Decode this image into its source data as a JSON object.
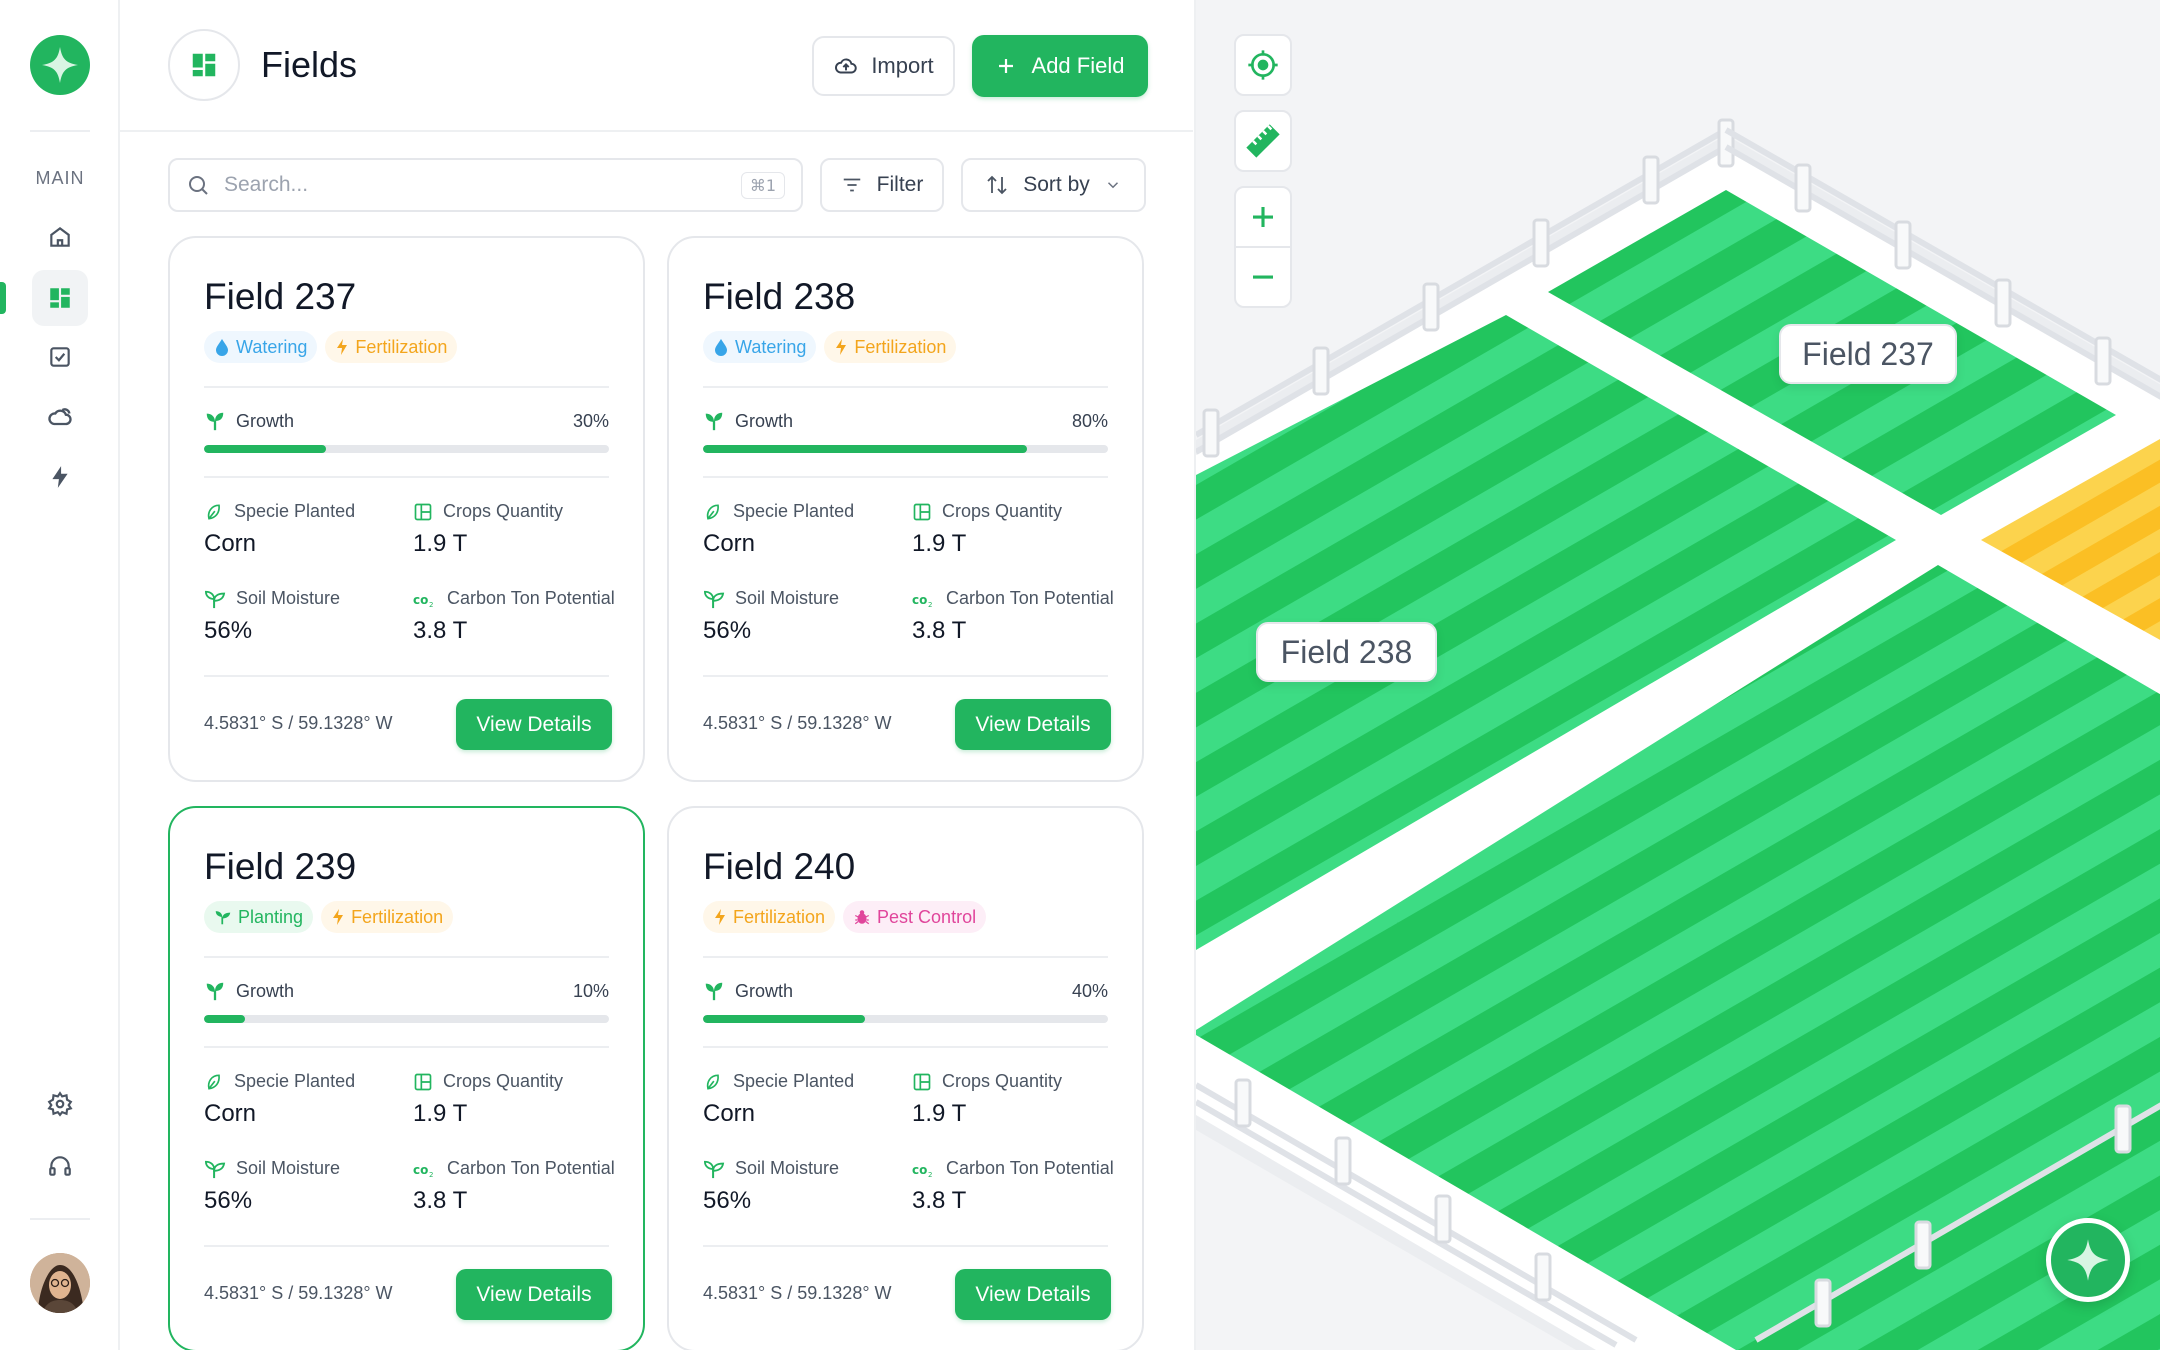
{
  "sidebar": {
    "section_label": "MAIN",
    "items": [
      {
        "name": "home-icon"
      },
      {
        "name": "dashboard-icon",
        "active": true
      },
      {
        "name": "tasks-icon"
      },
      {
        "name": "weather-icon"
      },
      {
        "name": "energy-icon"
      }
    ],
    "bottom_items": [
      {
        "name": "settings-icon"
      },
      {
        "name": "support-icon"
      }
    ]
  },
  "header": {
    "title": "Fields",
    "import_label": "Import",
    "add_label": "Add Field"
  },
  "toolbar": {
    "search_placeholder": "Search...",
    "search_shortcut": "⌘1",
    "filter_label": "Filter",
    "sort_label": "Sort by"
  },
  "cards": [
    {
      "title": "Field 237",
      "tags": [
        {
          "label": "Watering",
          "kind": "water"
        },
        {
          "label": "Fertilization",
          "kind": "fert"
        }
      ],
      "growth_label": "Growth",
      "growth_pct": "30%",
      "growth_value": 0.3,
      "specie_label": "Specie Planted",
      "specie": "Corn",
      "crops_label": "Crops Quantity",
      "crops": "1.9 T",
      "moisture_label": "Soil Moisture",
      "moisture": "56%",
      "carbon_label": "Carbon Ton Potential",
      "carbon": "3.8 T",
      "coords": "4.5831° S / 59.1328° W",
      "button": "View Details"
    },
    {
      "title": "Field 238",
      "tags": [
        {
          "label": "Watering",
          "kind": "water"
        },
        {
          "label": "Fertilization",
          "kind": "fert"
        }
      ],
      "growth_label": "Growth",
      "growth_pct": "80%",
      "growth_value": 0.8,
      "specie_label": "Specie Planted",
      "specie": "Corn",
      "crops_label": "Crops Quantity",
      "crops": "1.9 T",
      "moisture_label": "Soil Moisture",
      "moisture": "56%",
      "carbon_label": "Carbon Ton Potential",
      "carbon": "3.8 T",
      "coords": "4.5831° S / 59.1328° W",
      "button": "View Details"
    },
    {
      "title": "Field 239",
      "selected": true,
      "tags": [
        {
          "label": "Planting",
          "kind": "plant"
        },
        {
          "label": "Fertilization",
          "kind": "fert"
        }
      ],
      "growth_label": "Growth",
      "growth_pct": "10%",
      "growth_value": 0.1,
      "specie_label": "Specie Planted",
      "specie": "Corn",
      "crops_label": "Crops Quantity",
      "crops": "1.9 T",
      "moisture_label": "Soil Moisture",
      "moisture": "56%",
      "carbon_label": "Carbon Ton Potential",
      "carbon": "3.8 T",
      "coords": "4.5831° S / 59.1328° W",
      "button": "View Details"
    },
    {
      "title": "Field 240",
      "tags": [
        {
          "label": "Fertilization",
          "kind": "fert"
        },
        {
          "label": "Pest Control",
          "kind": "pest"
        }
      ],
      "growth_label": "Growth",
      "growth_pct": "40%",
      "growth_value": 0.4,
      "specie_label": "Specie Planted",
      "specie": "Corn",
      "crops_label": "Crops Quantity",
      "crops": "1.9 T",
      "moisture_label": "Soil Moisture",
      "moisture": "56%",
      "carbon_label": "Carbon Ton Potential",
      "carbon": "3.8 T",
      "coords": "4.5831° S / 59.1328° W",
      "button": "View Details"
    }
  ],
  "map": {
    "labels": {
      "field_a": "Field 237",
      "field_b": "Field 238"
    },
    "controls": [
      "locate-icon",
      "ruler-icon",
      "zoom-in-icon",
      "zoom-out-icon"
    ]
  },
  "colors": {
    "accent": "#22b55f",
    "field_green_light": "#3ddc84",
    "field_green_dark": "#22c55e",
    "field_yellow": "#fbbf24"
  }
}
